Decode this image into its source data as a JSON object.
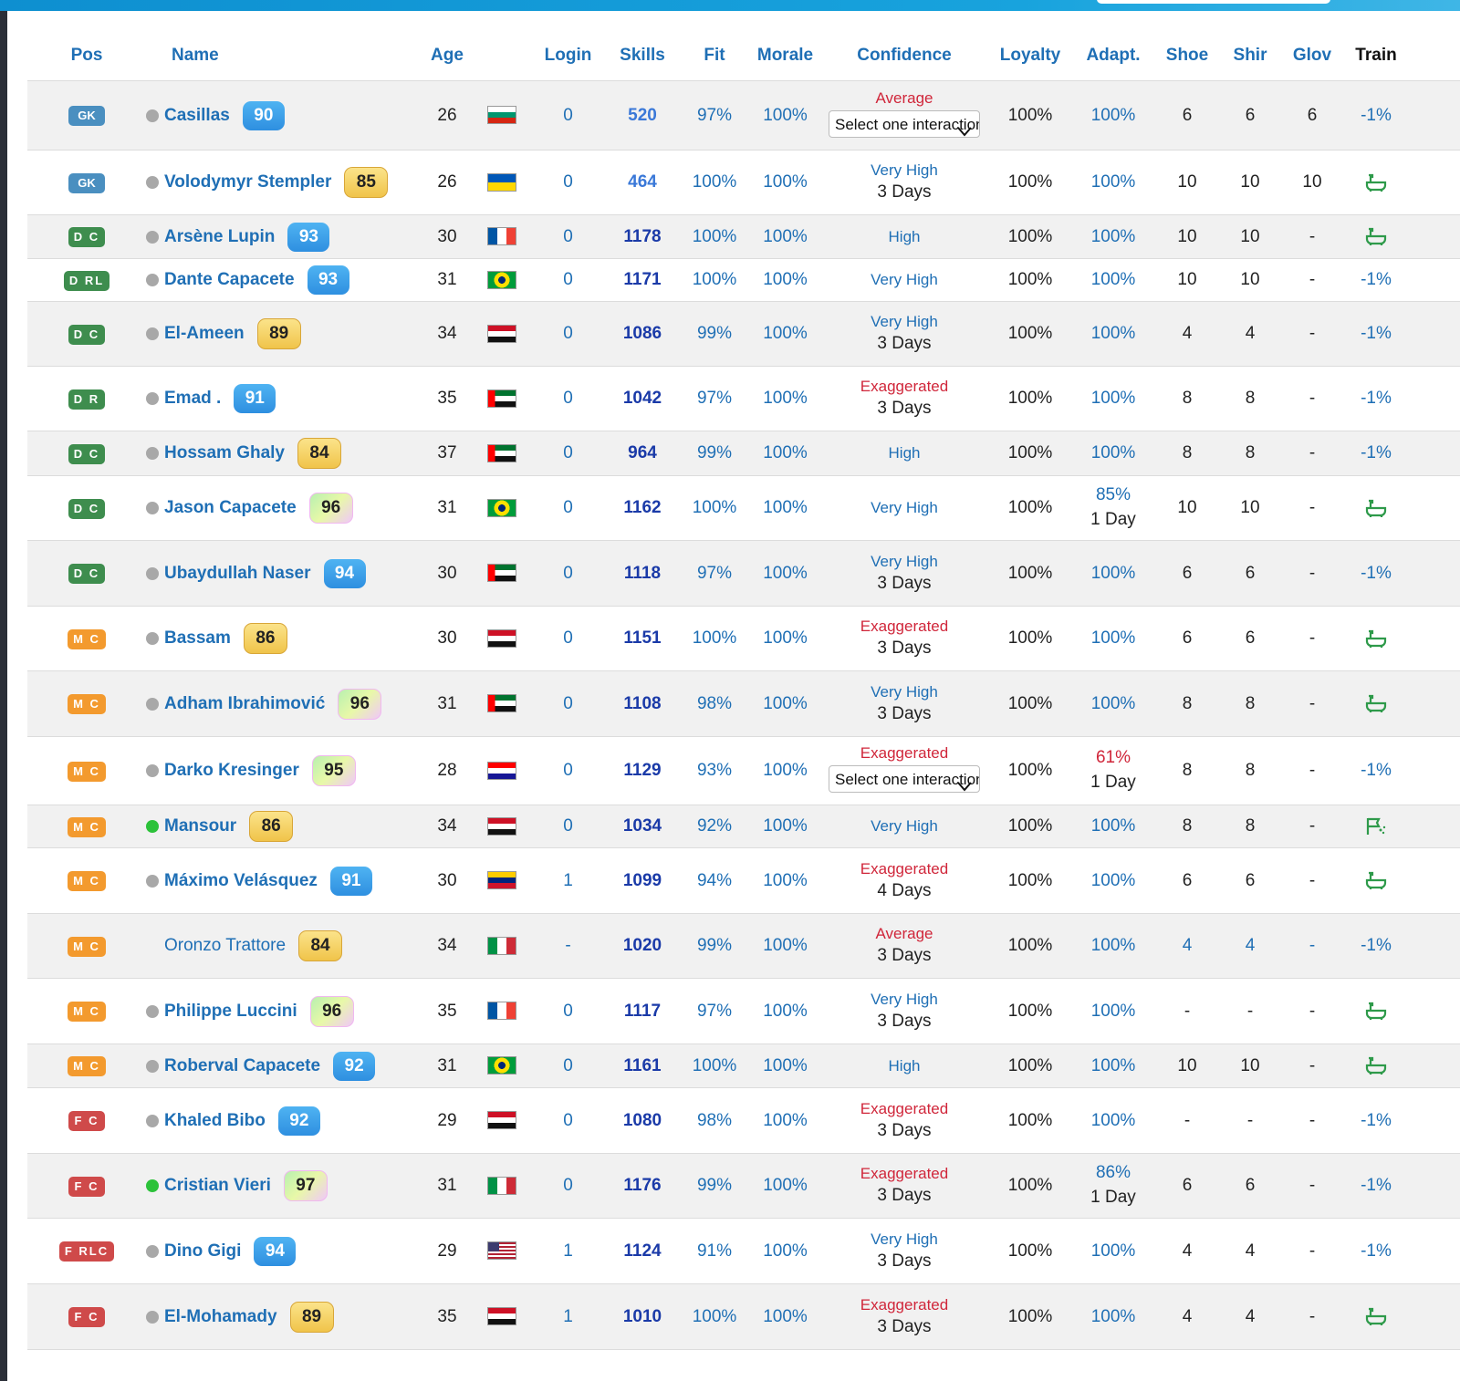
{
  "header": {
    "pos": "Pos",
    "name": "Name",
    "age": "Age",
    "login": "Login",
    "skills": "Skills",
    "fit": "Fit",
    "morale": "Morale",
    "confidence": "Confidence",
    "loyalty": "Loyalty",
    "adapt": "Adapt.",
    "shoe": "Shoe",
    "shir": "Shir",
    "glov": "Glov",
    "train": "Train"
  },
  "colors": {
    "accent_blue": "#1f6fb5",
    "skills_blue": "#1a3aa8",
    "red": "#d0263a",
    "train_green": "#2e9a4a"
  },
  "players": [
    {
      "pos": "GK",
      "pos_class": "gk",
      "dot": "grey",
      "name": "Casillas",
      "rating": "90",
      "rating_style": "blue",
      "age": "26",
      "flag": "bg",
      "login": "0",
      "skills": "520",
      "skills_light": true,
      "fit": "97%",
      "morale": "100%",
      "confidence": "Average",
      "conf_color": "red",
      "conf_select": "Select one interaction",
      "conf_sub": "",
      "loyalty": "100%",
      "adapt": "100%",
      "adapt_color": "blue",
      "adapt_sub": "",
      "shoe": "6",
      "shir": "6",
      "glov": "6",
      "train": "-1%",
      "train_type": "text",
      "height": 76
    },
    {
      "pos": "GK",
      "pos_class": "gk",
      "dot": "grey",
      "name": "Volodymyr Stempler",
      "rating": "85",
      "rating_style": "gold",
      "age": "26",
      "flag": "ua",
      "login": "0",
      "skills": "464",
      "skills_light": true,
      "fit": "100%",
      "morale": "100%",
      "confidence": "Very High",
      "conf_color": "blue",
      "conf_select": "",
      "conf_sub": "3 Days",
      "loyalty": "100%",
      "adapt": "100%",
      "adapt_color": "blue",
      "adapt_sub": "",
      "shoe": "10",
      "shir": "10",
      "glov": "10",
      "train": "",
      "train_type": "bath-icon",
      "height": 71
    },
    {
      "pos": "D C",
      "pos_class": "d",
      "dot": "grey",
      "name": "Arsène Lupin",
      "rating": "93",
      "rating_style": "blue",
      "age": "30",
      "flag": "fr",
      "login": "0",
      "skills": "1178",
      "skills_light": false,
      "fit": "100%",
      "morale": "100%",
      "confidence": "High",
      "conf_color": "blue",
      "conf_select": "",
      "conf_sub": "",
      "loyalty": "100%",
      "adapt": "100%",
      "adapt_color": "blue",
      "adapt_sub": "",
      "shoe": "10",
      "shir": "10",
      "glov": "-",
      "train": "",
      "train_type": "bath-icon",
      "height": 48
    },
    {
      "pos": "D RL",
      "pos_class": "d",
      "dot": "grey",
      "name": "Dante Capacete",
      "rating": "93",
      "rating_style": "blue",
      "age": "31",
      "flag": "br",
      "login": "0",
      "skills": "1171",
      "skills_light": false,
      "fit": "100%",
      "morale": "100%",
      "confidence": "Very High",
      "conf_color": "blue",
      "conf_select": "",
      "conf_sub": "",
      "loyalty": "100%",
      "adapt": "100%",
      "adapt_color": "blue",
      "adapt_sub": "",
      "shoe": "10",
      "shir": "10",
      "glov": "-",
      "train": "-1%",
      "train_type": "text",
      "height": 47
    },
    {
      "pos": "D C",
      "pos_class": "d",
      "dot": "grey",
      "name": "El-Ameen",
      "rating": "89",
      "rating_style": "gold",
      "age": "34",
      "flag": "eg",
      "login": "0",
      "skills": "1086",
      "skills_light": false,
      "fit": "99%",
      "morale": "100%",
      "confidence": "Very High",
      "conf_color": "blue",
      "conf_select": "",
      "conf_sub": "3 Days",
      "loyalty": "100%",
      "adapt": "100%",
      "adapt_color": "blue",
      "adapt_sub": "",
      "shoe": "4",
      "shir": "4",
      "glov": "-",
      "train": "-1%",
      "train_type": "text",
      "height": 71
    },
    {
      "pos": "D R",
      "pos_class": "d",
      "dot": "grey",
      "name": "Emad .",
      "rating": "91",
      "rating_style": "blue",
      "age": "35",
      "flag": "ae",
      "login": "0",
      "skills": "1042",
      "skills_light": false,
      "fit": "97%",
      "morale": "100%",
      "confidence": "Exaggerated",
      "conf_color": "red",
      "conf_select": "",
      "conf_sub": "3 Days",
      "loyalty": "100%",
      "adapt": "100%",
      "adapt_color": "blue",
      "adapt_sub": "",
      "shoe": "8",
      "shir": "8",
      "glov": "-",
      "train": "-1%",
      "train_type": "text",
      "height": 71
    },
    {
      "pos": "D C",
      "pos_class": "d",
      "dot": "grey",
      "name": "Hossam Ghaly",
      "rating": "84",
      "rating_style": "gold",
      "age": "37",
      "flag": "ae",
      "login": "0",
      "skills": "964",
      "skills_light": false,
      "fit": "99%",
      "morale": "100%",
      "confidence": "High",
      "conf_color": "blue",
      "conf_select": "",
      "conf_sub": "",
      "loyalty": "100%",
      "adapt": "100%",
      "adapt_color": "blue",
      "adapt_sub": "",
      "shoe": "8",
      "shir": "8",
      "glov": "-",
      "train": "-1%",
      "train_type": "text",
      "height": 49
    },
    {
      "pos": "D C",
      "pos_class": "d",
      "dot": "grey",
      "name": "Jason Capacete",
      "rating": "96",
      "rating_style": "rainbow",
      "age": "31",
      "flag": "br",
      "login": "0",
      "skills": "1162",
      "skills_light": false,
      "fit": "100%",
      "morale": "100%",
      "confidence": "Very High",
      "conf_color": "blue",
      "conf_select": "",
      "conf_sub": "",
      "loyalty": "100%",
      "adapt": "85%",
      "adapt_color": "blue",
      "adapt_sub": "1 Day",
      "shoe": "10",
      "shir": "10",
      "glov": "-",
      "train": "",
      "train_type": "bath-icon",
      "height": 71
    },
    {
      "pos": "D C",
      "pos_class": "d",
      "dot": "grey",
      "name": "Ubaydullah Naser",
      "rating": "94",
      "rating_style": "blue",
      "age": "30",
      "flag": "ae",
      "login": "0",
      "skills": "1118",
      "skills_light": false,
      "fit": "97%",
      "morale": "100%",
      "confidence": "Very High",
      "conf_color": "blue",
      "conf_select": "",
      "conf_sub": "3 Days",
      "loyalty": "100%",
      "adapt": "100%",
      "adapt_color": "blue",
      "adapt_sub": "",
      "shoe": "6",
      "shir": "6",
      "glov": "-",
      "train": "-1%",
      "train_type": "text",
      "height": 72
    },
    {
      "pos": "M C",
      "pos_class": "m",
      "dot": "grey",
      "name": "Bassam",
      "rating": "86",
      "rating_style": "gold",
      "age": "30",
      "flag": "eg",
      "login": "0",
      "skills": "1151",
      "skills_light": false,
      "fit": "100%",
      "morale": "100%",
      "confidence": "Exaggerated",
      "conf_color": "red",
      "conf_select": "",
      "conf_sub": "3 Days",
      "loyalty": "100%",
      "adapt": "100%",
      "adapt_color": "blue",
      "adapt_sub": "",
      "shoe": "6",
      "shir": "6",
      "glov": "-",
      "train": "",
      "train_type": "bath-icon",
      "height": 71
    },
    {
      "pos": "M C",
      "pos_class": "m",
      "dot": "grey",
      "name": "Adham Ibrahimović",
      "rating": "96",
      "rating_style": "rainbow",
      "age": "31",
      "flag": "ae",
      "login": "0",
      "skills": "1108",
      "skills_light": false,
      "fit": "98%",
      "morale": "100%",
      "confidence": "Very High",
      "conf_color": "blue",
      "conf_select": "",
      "conf_sub": "3 Days",
      "loyalty": "100%",
      "adapt": "100%",
      "adapt_color": "blue",
      "adapt_sub": "",
      "shoe": "8",
      "shir": "8",
      "glov": "-",
      "train": "",
      "train_type": "bath-icon",
      "height": 72
    },
    {
      "pos": "M C",
      "pos_class": "m",
      "dot": "grey",
      "name": "Darko Kresinger",
      "rating": "95",
      "rating_style": "rainbow",
      "age": "28",
      "flag": "hr",
      "login": "0",
      "skills": "1129",
      "skills_light": false,
      "fit": "93%",
      "morale": "100%",
      "confidence": "Exaggerated",
      "conf_color": "red",
      "conf_select": "Select one interaction",
      "conf_sub": "",
      "loyalty": "100%",
      "adapt": "61%",
      "adapt_color": "red",
      "adapt_sub": "1 Day",
      "shoe": "8",
      "shir": "8",
      "glov": "-",
      "train": "-1%",
      "train_type": "text",
      "height": 75
    },
    {
      "pos": "M C",
      "pos_class": "m",
      "dot": "green",
      "name": "Mansour",
      "rating": "86",
      "rating_style": "gold",
      "age": "34",
      "flag": "eg",
      "login": "0",
      "skills": "1034",
      "skills_light": false,
      "fit": "92%",
      "morale": "100%",
      "confidence": "Very High",
      "conf_color": "blue",
      "conf_select": "",
      "conf_sub": "",
      "loyalty": "100%",
      "adapt": "100%",
      "adapt_color": "blue",
      "adapt_sub": "",
      "shoe": "8",
      "shir": "8",
      "glov": "-",
      "train": "",
      "train_type": "field-icon",
      "height": 47
    },
    {
      "pos": "M C",
      "pos_class": "m",
      "dot": "grey",
      "name": "Máximo Velásquez",
      "rating": "91",
      "rating_style": "blue",
      "age": "30",
      "flag": "ve",
      "login": "1",
      "skills": "1099",
      "skills_light": false,
      "fit": "94%",
      "morale": "100%",
      "confidence": "Exaggerated",
      "conf_color": "red",
      "conf_select": "",
      "conf_sub": "4 Days",
      "loyalty": "100%",
      "adapt": "100%",
      "adapt_color": "blue",
      "adapt_sub": "",
      "shoe": "6",
      "shir": "6",
      "glov": "-",
      "train": "",
      "train_type": "bath-icon",
      "height": 72
    },
    {
      "pos": "M C",
      "pos_class": "m",
      "dot": "none",
      "name": "Oronzo Trattore",
      "rating": "84",
      "rating_style": "gold",
      "age": "34",
      "flag": "it",
      "login": "-",
      "skills": "1020",
      "skills_light": false,
      "fit": "99%",
      "morale": "100%",
      "confidence": "Average",
      "conf_color": "red",
      "conf_select": "",
      "conf_sub": "3 Days",
      "loyalty": "100%",
      "adapt": "100%",
      "adapt_color": "blue",
      "adapt_sub": "",
      "shoe": "4",
      "shir": "4",
      "glov": "-",
      "train": "-1%",
      "train_type": "text",
      "height": 71,
      "plain": true
    },
    {
      "pos": "M C",
      "pos_class": "m",
      "dot": "grey",
      "name": "Philippe Luccini",
      "rating": "96",
      "rating_style": "rainbow",
      "age": "35",
      "flag": "fr",
      "login": "0",
      "skills": "1117",
      "skills_light": false,
      "fit": "97%",
      "morale": "100%",
      "confidence": "Very High",
      "conf_color": "blue",
      "conf_select": "",
      "conf_sub": "3 Days",
      "loyalty": "100%",
      "adapt": "100%",
      "adapt_color": "blue",
      "adapt_sub": "",
      "shoe": "-",
      "shir": "-",
      "glov": "-",
      "train": "",
      "train_type": "bath-icon",
      "height": 72
    },
    {
      "pos": "M C",
      "pos_class": "m",
      "dot": "grey",
      "name": "Roberval Capacete",
      "rating": "92",
      "rating_style": "blue",
      "age": "31",
      "flag": "br",
      "login": "0",
      "skills": "1161",
      "skills_light": false,
      "fit": "100%",
      "morale": "100%",
      "confidence": "High",
      "conf_color": "blue",
      "conf_select": "",
      "conf_sub": "",
      "loyalty": "100%",
      "adapt": "100%",
      "adapt_color": "blue",
      "adapt_sub": "",
      "shoe": "10",
      "shir": "10",
      "glov": "-",
      "train": "",
      "train_type": "bath-icon",
      "height": 48
    },
    {
      "pos": "F C",
      "pos_class": "f",
      "dot": "grey",
      "name": "Khaled Bibo",
      "rating": "92",
      "rating_style": "blue",
      "age": "29",
      "flag": "eg",
      "login": "0",
      "skills": "1080",
      "skills_light": false,
      "fit": "98%",
      "morale": "100%",
      "confidence": "Exaggerated",
      "conf_color": "red",
      "conf_select": "",
      "conf_sub": "3 Days",
      "loyalty": "100%",
      "adapt": "100%",
      "adapt_color": "blue",
      "adapt_sub": "",
      "shoe": "-",
      "shir": "-",
      "glov": "-",
      "train": "-1%",
      "train_type": "text",
      "height": 72
    },
    {
      "pos": "F C",
      "pos_class": "f",
      "dot": "green",
      "name": "Cristian Vieri",
      "rating": "97",
      "rating_style": "rainbow",
      "age": "31",
      "flag": "it",
      "login": "0",
      "skills": "1176",
      "skills_light": false,
      "fit": "99%",
      "morale": "100%",
      "confidence": "Exaggerated",
      "conf_color": "red",
      "conf_select": "",
      "conf_sub": "3 Days",
      "loyalty": "100%",
      "adapt": "86%",
      "adapt_color": "blue",
      "adapt_sub": "1 Day",
      "shoe": "6",
      "shir": "6",
      "glov": "-",
      "train": "-1%",
      "train_type": "text",
      "height": 71
    },
    {
      "pos": "F RLC",
      "pos_class": "f",
      "dot": "grey",
      "name": "Dino Gigi",
      "rating": "94",
      "rating_style": "blue",
      "age": "29",
      "flag": "us",
      "login": "1",
      "skills": "1124",
      "skills_light": false,
      "fit": "91%",
      "morale": "100%",
      "confidence": "Very High",
      "conf_color": "blue",
      "conf_select": "",
      "conf_sub": "3 Days",
      "loyalty": "100%",
      "adapt": "100%",
      "adapt_color": "blue",
      "adapt_sub": "",
      "shoe": "4",
      "shir": "4",
      "glov": "-",
      "train": "-1%",
      "train_type": "text",
      "height": 72
    },
    {
      "pos": "F C",
      "pos_class": "f",
      "dot": "grey",
      "name": "El-Mohamady",
      "rating": "89",
      "rating_style": "gold",
      "age": "35",
      "flag": "eg",
      "login": "1",
      "skills": "1010",
      "skills_light": false,
      "fit": "100%",
      "morale": "100%",
      "confidence": "Exaggerated",
      "conf_color": "red",
      "conf_select": "",
      "conf_sub": "3 Days",
      "loyalty": "100%",
      "adapt": "100%",
      "adapt_color": "blue",
      "adapt_sub": "",
      "shoe": "4",
      "shir": "4",
      "glov": "-",
      "train": "",
      "train_type": "bath-icon",
      "height": 72
    }
  ]
}
